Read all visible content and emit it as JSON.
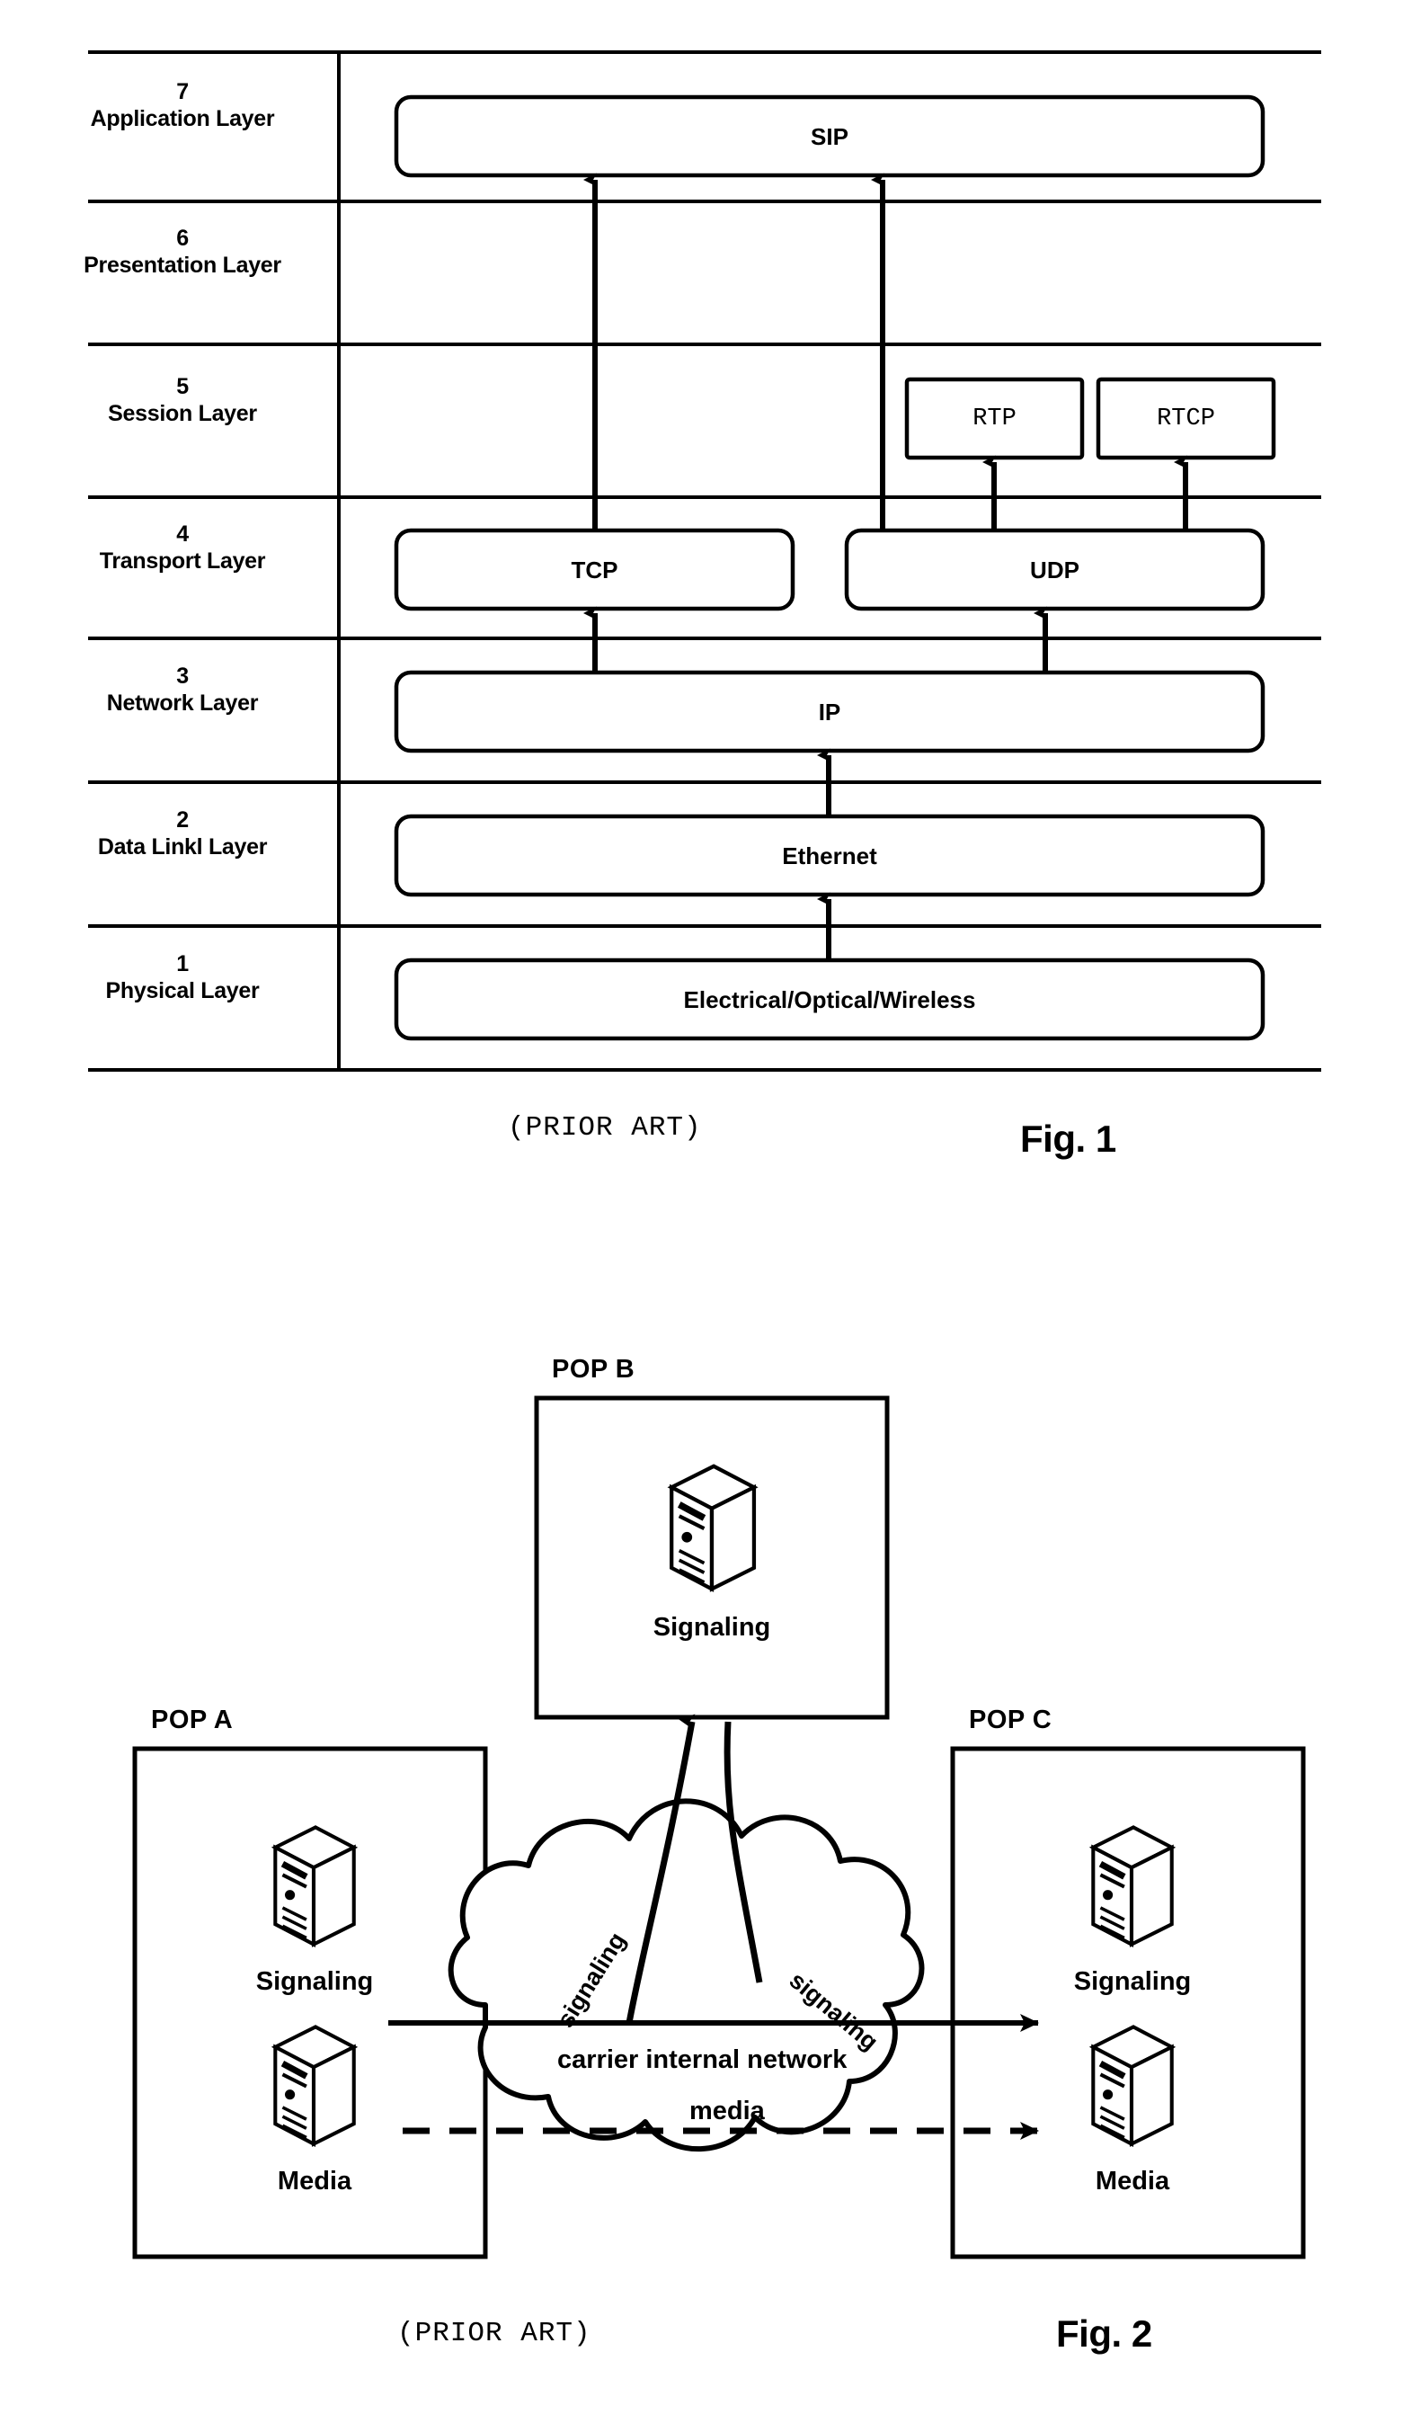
{
  "figure1": {
    "caption": "Fig. 1",
    "prior_art": "(PRIOR ART)",
    "layers": [
      {
        "number": "7",
        "name": "Application Layer"
      },
      {
        "number": "6",
        "name": "Presentation Layer"
      },
      {
        "number": "5",
        "name": "Session Layer"
      },
      {
        "number": "4",
        "name": "Transport Layer"
      },
      {
        "number": "3",
        "name": "Network Layer"
      },
      {
        "number": "2",
        "name": "Data Linkl Layer"
      },
      {
        "number": "1",
        "name": "Physical Layer"
      }
    ],
    "protocols": {
      "sip": "SIP",
      "rtp": "RTP",
      "rtcp": "RTCP",
      "tcp": "TCP",
      "udp": "UDP",
      "ip": "IP",
      "ethernet": "Ethernet",
      "physical": "Electrical/Optical/Wireless"
    }
  },
  "figure2": {
    "caption": "Fig. 2",
    "prior_art": "(PRIOR ART)",
    "pops": [
      {
        "id": "pop-a",
        "label": "POP A",
        "nodes": [
          "Signaling",
          "Media"
        ]
      },
      {
        "id": "pop-b",
        "label": "POP B",
        "nodes": [
          "Signaling"
        ]
      },
      {
        "id": "pop-c",
        "label": "POP C",
        "nodes": [
          "Signaling",
          "Media"
        ]
      }
    ],
    "cloud": {
      "label": "carrier internal network",
      "signaling_left": "signaling",
      "signaling_right": "signaling",
      "media": "media"
    }
  },
  "colors": {
    "ink": "#000000",
    "paper": "#ffffff"
  }
}
